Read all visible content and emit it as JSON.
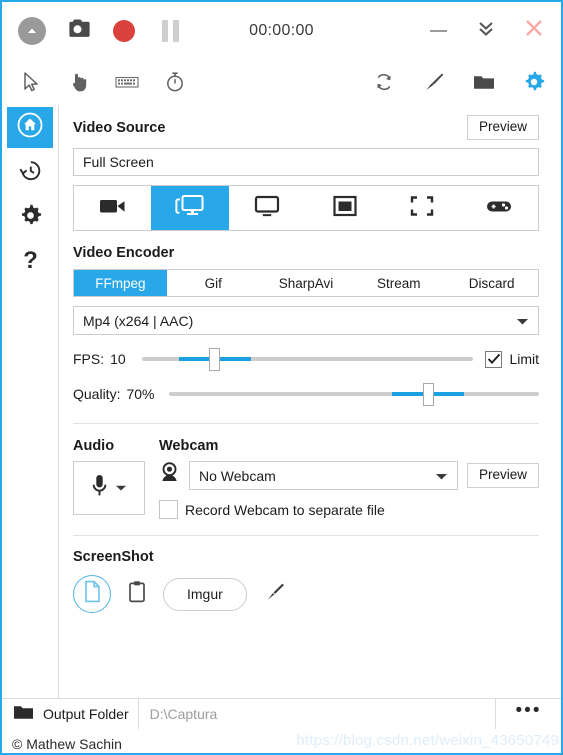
{
  "window": {
    "accent_color": "#28a8e8",
    "border_color": "#28a8e8"
  },
  "titlebar": {
    "collapse_icon": "chevron-up-circle-icon",
    "screenshot_icon": "camera-icon",
    "record_icon": "record-circle-icon",
    "pause_icon": "pause-icon",
    "timer": "00:00:00",
    "minimize_label": "minimize-icon",
    "collapse_label": "double-chevron-down-icon",
    "close_label": "close-icon"
  },
  "toolstrip": {
    "left": [
      {
        "name": "cursor-icon"
      },
      {
        "name": "mouse-clicks-icon"
      },
      {
        "name": "keystrokes-icon"
      },
      {
        "name": "timer-icon"
      }
    ],
    "right": [
      {
        "name": "refresh-icon"
      },
      {
        "name": "brush-icon"
      },
      {
        "name": "folder-icon"
      },
      {
        "name": "gear-icon"
      }
    ]
  },
  "sidebar": {
    "items": [
      {
        "name": "home-icon",
        "label": "Home",
        "active": true
      },
      {
        "name": "history-icon",
        "label": "Recent",
        "active": false
      },
      {
        "name": "gear-icon",
        "label": "Configure",
        "active": false
      },
      {
        "name": "help-icon",
        "label": "About",
        "active": false
      }
    ]
  },
  "video_source": {
    "heading": "Video Source",
    "preview_label": "Preview",
    "selected_value": "Full Screen",
    "modes": [
      {
        "name": "video-camera-icon",
        "active": false
      },
      {
        "name": "screens-icon",
        "active": true
      },
      {
        "name": "desktop-monitor-icon",
        "active": false
      },
      {
        "name": "window-icon",
        "active": false
      },
      {
        "name": "region-icon",
        "active": false
      },
      {
        "name": "gamepad-icon",
        "active": false
      }
    ]
  },
  "video_encoder": {
    "heading": "Video Encoder",
    "tabs": [
      {
        "label": "FFmpeg",
        "active": true
      },
      {
        "label": "Gif",
        "active": false
      },
      {
        "label": "SharpAvi",
        "active": false
      },
      {
        "label": "Stream",
        "active": false
      },
      {
        "label": "Discard",
        "active": false
      }
    ],
    "format_value": "Mp4 (x264 | AAC)",
    "fps_label": "FPS:",
    "fps_value": "10",
    "fps_percent": 22,
    "limit_label": "Limit",
    "limit_checked": true,
    "quality_label": "Quality:",
    "quality_value": "70%",
    "quality_percent": 70
  },
  "audio": {
    "heading": "Audio",
    "mic_icon": "microphone-icon",
    "dropdown_icon": "chevron-down-icon"
  },
  "webcam": {
    "heading": "Webcam",
    "icon": "webcam-icon",
    "selected_value": "No Webcam",
    "preview_label": "Preview",
    "separate_file_label": "Record Webcam to separate file",
    "separate_file_checked": false
  },
  "screenshot": {
    "heading": "ScreenShot",
    "targets": [
      {
        "name": "file-icon",
        "active": true
      },
      {
        "name": "clipboard-icon",
        "active": false
      }
    ],
    "imgur_label": "Imgur",
    "edit_icon": "pencil-icon"
  },
  "footer": {
    "folder_icon": "folder-icon",
    "output_folder_label": "Output Folder",
    "output_path": "D:\\Captura",
    "more_label": "•••"
  },
  "statusbar": {
    "text": "© Mathew Sachin",
    "watermark": "https://blog.csdn.net/weixin_43650749"
  }
}
